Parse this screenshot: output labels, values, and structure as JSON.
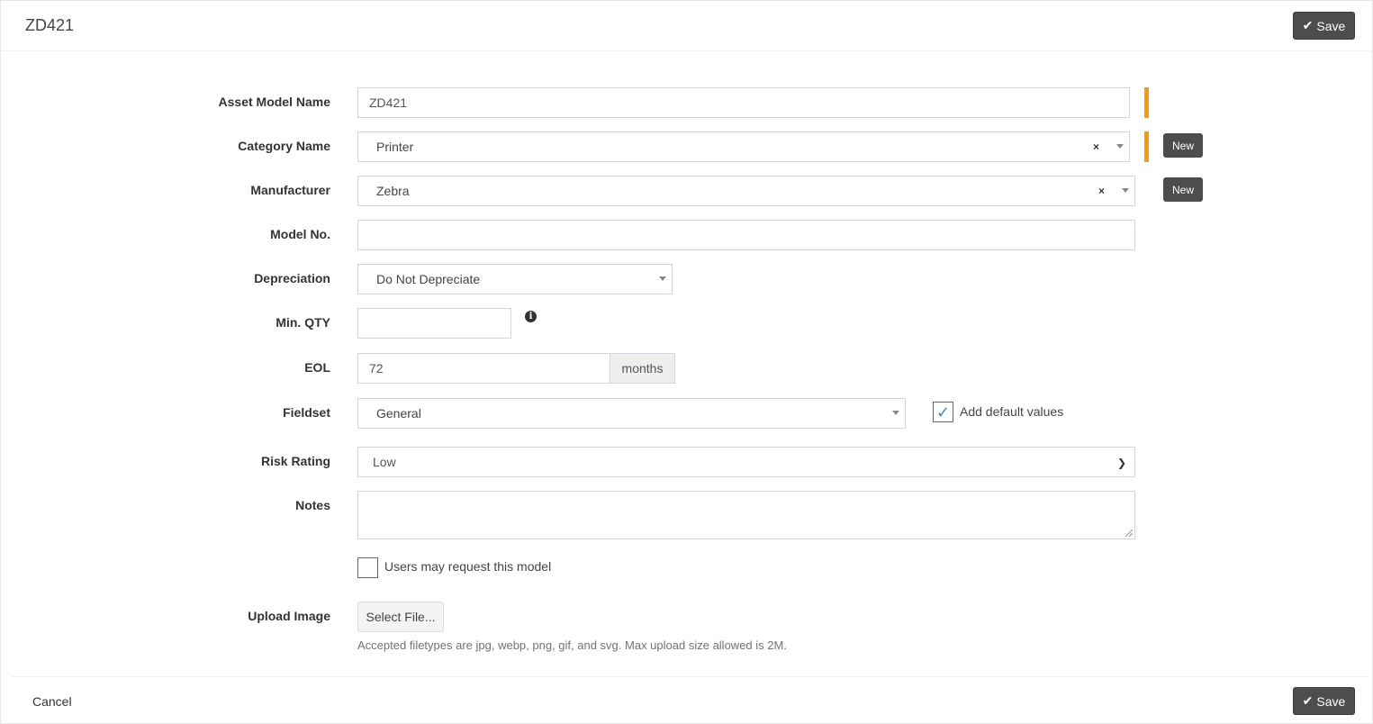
{
  "header": {
    "title": "ZD421",
    "save_label": "Save"
  },
  "form": {
    "asset_model_name": {
      "label": "Asset Model Name",
      "value": "ZD421"
    },
    "category_name": {
      "label": "Category Name",
      "value": "Printer",
      "new_label": "New"
    },
    "manufacturer": {
      "label": "Manufacturer",
      "value": "Zebra",
      "new_label": "New"
    },
    "model_no": {
      "label": "Model No.",
      "value": ""
    },
    "depreciation": {
      "label": "Depreciation",
      "value": "Do Not Depreciate"
    },
    "min_qty": {
      "label": "Min. QTY",
      "value": ""
    },
    "eol": {
      "label": "EOL",
      "value": "72",
      "addon": "months"
    },
    "fieldset": {
      "label": "Fieldset",
      "value": "General",
      "checkbox_label": "Add default values",
      "checked": true
    },
    "risk_rating": {
      "label": "Risk Rating",
      "value": "Low"
    },
    "notes": {
      "label": "Notes",
      "value": ""
    },
    "requestable": {
      "label": "Users may request this model",
      "checked": false
    },
    "upload_image": {
      "label": "Upload Image",
      "button_label": "Select File...",
      "help": "Accepted filetypes are jpg, webp, png, gif, and svg. Max upload size allowed is 2M."
    }
  },
  "footer": {
    "cancel_label": "Cancel",
    "save_label": "Save"
  },
  "colors": {
    "required": "#f39c12",
    "button_dark": "#4d4d4d",
    "check": "#3c8dbc"
  }
}
